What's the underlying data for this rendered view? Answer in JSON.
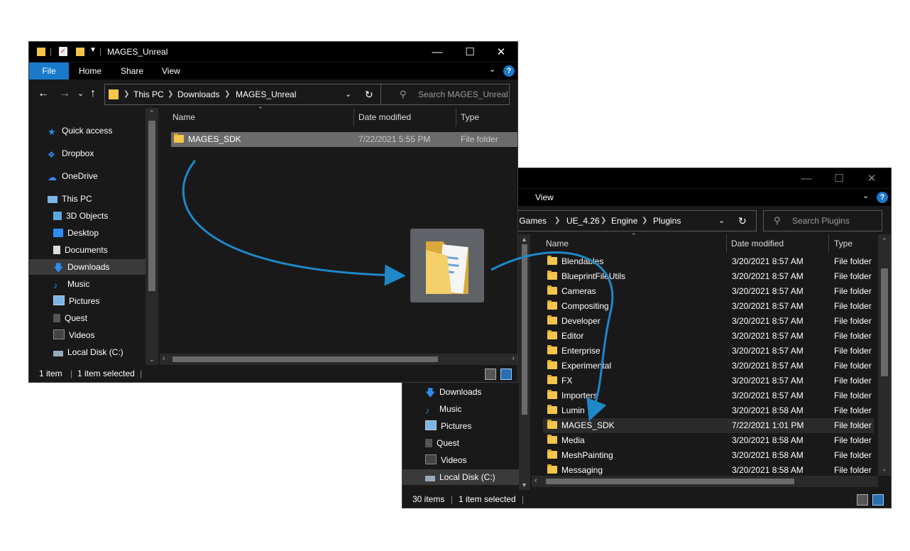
{
  "window1": {
    "title": "MAGES_Unreal",
    "ribbon_tabs": [
      "File",
      "Home",
      "Share",
      "View"
    ],
    "breadcrumb": [
      "This PC",
      "Downloads",
      "MAGES_Unreal"
    ],
    "search_placeholder": "Search MAGES_Unreal",
    "nav": [
      {
        "label": "Quick access",
        "icon": "star-icon"
      },
      {
        "label": "Dropbox",
        "icon": "dropbox-icon"
      },
      {
        "label": "OneDrive",
        "icon": "cloud-icon"
      },
      {
        "label": "This PC",
        "icon": "computer-icon"
      },
      {
        "label": "3D Objects",
        "icon": "cube-icon"
      },
      {
        "label": "Desktop",
        "icon": "desktop-icon"
      },
      {
        "label": "Documents",
        "icon": "document-icon"
      },
      {
        "label": "Downloads",
        "icon": "download-arrow-icon"
      },
      {
        "label": "Music",
        "icon": "music-note-icon"
      },
      {
        "label": "Pictures",
        "icon": "picture-icon"
      },
      {
        "label": "Quest",
        "icon": "device-icon"
      },
      {
        "label": "Videos",
        "icon": "film-icon"
      },
      {
        "label": "Local Disk (C:)",
        "icon": "drive-icon"
      }
    ],
    "columns": [
      "Name",
      "Date modified",
      "Type"
    ],
    "rows": [
      {
        "name": "MAGES_SDK",
        "date": "7/22/2021 5:55 PM",
        "type": "File folder"
      }
    ],
    "status": {
      "count": "1 item",
      "selected": "1 item selected"
    }
  },
  "window2": {
    "ribbon_tabs": [
      "View"
    ],
    "breadcrumb": [
      "c Games",
      "UE_4.26",
      "Engine",
      "Plugins"
    ],
    "search_placeholder": "Search Plugins",
    "nav": [
      {
        "label": "Downloads",
        "icon": "download-arrow-icon"
      },
      {
        "label": "Music",
        "icon": "music-note-icon"
      },
      {
        "label": "Pictures",
        "icon": "picture-icon"
      },
      {
        "label": "Quest",
        "icon": "device-icon"
      },
      {
        "label": "Videos",
        "icon": "film-icon"
      },
      {
        "label": "Local Disk (C:)",
        "icon": "drive-icon"
      }
    ],
    "columns": [
      "Name",
      "Date modified",
      "Type"
    ],
    "rows": [
      {
        "name": "Blendables",
        "date": "3/20/2021 8:57 AM",
        "type": "File folder"
      },
      {
        "name": "BlueprintFileUtils",
        "date": "3/20/2021 8:57 AM",
        "type": "File folder"
      },
      {
        "name": "Cameras",
        "date": "3/20/2021 8:57 AM",
        "type": "File folder"
      },
      {
        "name": "Compositing",
        "date": "3/20/2021 8:57 AM",
        "type": "File folder"
      },
      {
        "name": "Developer",
        "date": "3/20/2021 8:57 AM",
        "type": "File folder"
      },
      {
        "name": "Editor",
        "date": "3/20/2021 8:57 AM",
        "type": "File folder"
      },
      {
        "name": "Enterprise",
        "date": "3/20/2021 8:57 AM",
        "type": "File folder"
      },
      {
        "name": "Experimental",
        "date": "3/20/2021 8:57 AM",
        "type": "File folder"
      },
      {
        "name": "FX",
        "date": "3/20/2021 8:57 AM",
        "type": "File folder"
      },
      {
        "name": "Importers",
        "date": "3/20/2021 8:57 AM",
        "type": "File folder"
      },
      {
        "name": "Lumin",
        "date": "3/20/2021 8:58 AM",
        "type": "File folder"
      },
      {
        "name": "MAGES_SDK",
        "date": "7/22/2021 1:01 PM",
        "type": "File folder"
      },
      {
        "name": "Media",
        "date": "3/20/2021 8:58 AM",
        "type": "File folder"
      },
      {
        "name": "MeshPainting",
        "date": "3/20/2021 8:58 AM",
        "type": "File folder"
      },
      {
        "name": "Messaging",
        "date": "3/20/2021 8:58 AM",
        "type": "File folder"
      }
    ],
    "status": {
      "count": "30 items",
      "selected": "1 item selected"
    }
  },
  "colors": {
    "accent": "#1979ca",
    "arrow": "#1e88c8",
    "folder": "#f4c54a",
    "selection": "#3a3a3a"
  }
}
